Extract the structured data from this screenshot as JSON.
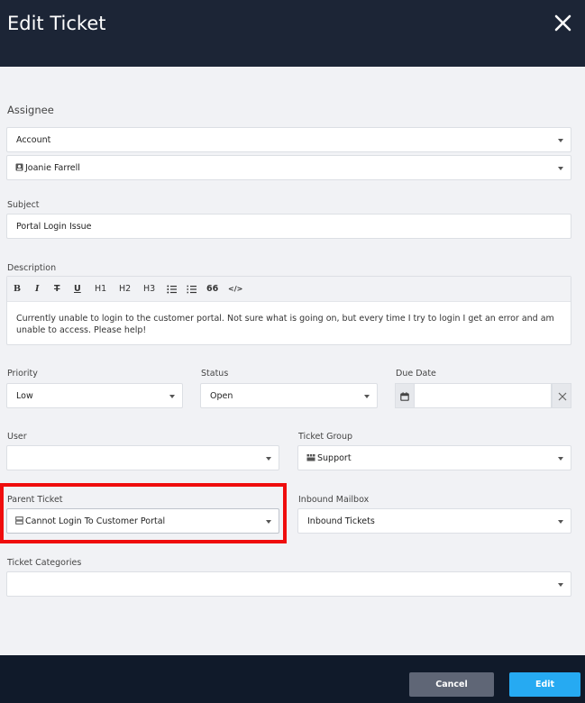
{
  "header": {
    "title": "Edit Ticket"
  },
  "assignee": {
    "label": "Assignee",
    "account": "Account",
    "user": "Joanie Farrell"
  },
  "subject": {
    "label": "Subject",
    "value": "Portal Login Issue"
  },
  "description": {
    "label": "Description",
    "toolbar": [
      "B",
      "I",
      "T",
      "U",
      "H1",
      "H2",
      "H3",
      "ul",
      "ol",
      "66",
      "</>"
    ],
    "text": "Currently unable to login to the customer portal. Not sure what is going on, but every time I try to login I get an error and am unable to access. Please help!"
  },
  "priority": {
    "label": "Priority",
    "value": "Low"
  },
  "status": {
    "label": "Status",
    "value": "Open"
  },
  "due_date": {
    "label": "Due Date",
    "value": ""
  },
  "user": {
    "label": "User",
    "value": ""
  },
  "ticket_group": {
    "label": "Ticket Group",
    "value": "Support"
  },
  "parent_ticket": {
    "label": "Parent Ticket",
    "value": "Cannot Login To Customer Portal"
  },
  "inbound_mailbox": {
    "label": "Inbound Mailbox",
    "value": "Inbound Tickets"
  },
  "ticket_categories": {
    "label": "Ticket Categories",
    "value": ""
  },
  "footer": {
    "cancel_label": "Cancel",
    "edit_label": "Edit"
  },
  "colors": {
    "header_bg": "#1c2536",
    "footer_bg": "#101a2a",
    "edit_button": "#26aaf2",
    "cancel_button": "#5f6676",
    "highlight": "#ef0d0d"
  }
}
